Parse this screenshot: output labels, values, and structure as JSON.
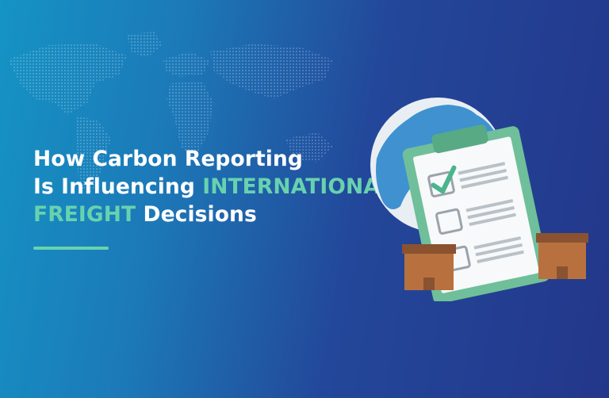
{
  "headline": {
    "line1": "How Carbon Reporting",
    "line2_prefix": "Is Influencing ",
    "line2_accent": "INTERNATIONAL",
    "line3_accent": "FREIGHT",
    "line3_suffix": " Decisions"
  },
  "colors": {
    "accent": "#67d2ae",
    "background_start": "#1593c4",
    "background_end": "#23378a",
    "clipboard": "#6fbf9a",
    "box": "#b8713e"
  },
  "icons": [
    "world-map-icon",
    "globe-icon",
    "clipboard-icon",
    "checkmark-icon",
    "cardboard-box-icon"
  ]
}
